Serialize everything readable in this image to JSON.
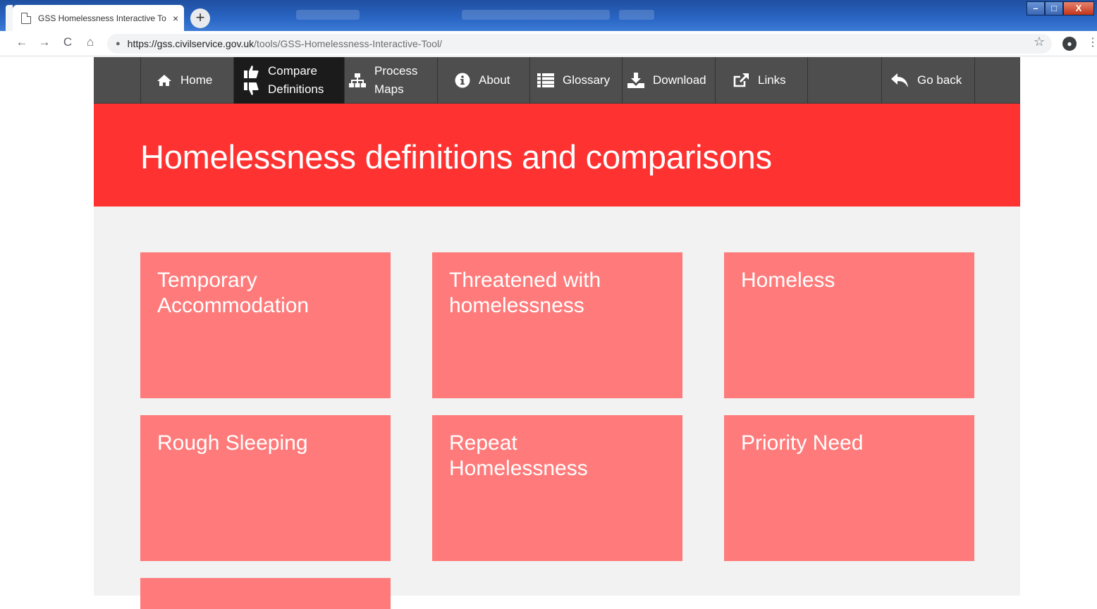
{
  "browser": {
    "tab_title": "GSS Homelessness Interactive To",
    "tab_close": "×",
    "new_tab": "+",
    "url_host": "https://gss.civilservice.gov.uk",
    "url_path": "/tools/GSS-Homelessness-Interactive-Tool/",
    "nav_back": "←",
    "nav_forward": "→",
    "nav_reload": "C",
    "nav_home": "⌂",
    "star": "☆",
    "menu": "⋮",
    "win_minimize": "–",
    "win_maximize": "□",
    "win_close": "X"
  },
  "site_nav": {
    "items": [
      {
        "label_1": "Home",
        "label_2": "",
        "icon": "home-icon"
      },
      {
        "label_1": "Compare",
        "label_2": "Definitions",
        "icon": "thumbs-up-down-icon",
        "active": true
      },
      {
        "label_1": "Process",
        "label_2": "Maps",
        "icon": "sitemap-icon"
      },
      {
        "label_1": "About",
        "label_2": "",
        "icon": "info-icon"
      },
      {
        "label_1": "Glossary",
        "label_2": "",
        "icon": "list-icon"
      },
      {
        "label_1": "Download",
        "label_2": "",
        "icon": "download-icon"
      },
      {
        "label_1": "Links",
        "label_2": "",
        "icon": "external-link-icon"
      },
      {
        "label_1": "Go back",
        "label_2": "",
        "icon": "reply-arrow-icon"
      }
    ]
  },
  "banner": {
    "title": "Homelessness definitions and comparisons",
    "color": "#ff3232"
  },
  "cards": [
    {
      "line_1": "Temporary",
      "line_2": "Accommodation"
    },
    {
      "line_1": "Threatened with",
      "line_2": "homelessness"
    },
    {
      "line_1": "Homeless",
      "line_2": ""
    },
    {
      "line_1": "Rough Sleeping",
      "line_2": ""
    },
    {
      "line_1": "Repeat",
      "line_2": "Homelessness"
    },
    {
      "line_1": "Priority Need",
      "line_2": ""
    },
    {
      "line_1": "",
      "line_2": ""
    }
  ],
  "colors": {
    "card": "#ff7b7b",
    "nav_bg": "#4e4e4e",
    "nav_active": "#1b1b1b",
    "page_bg": "#f2f2f2"
  }
}
